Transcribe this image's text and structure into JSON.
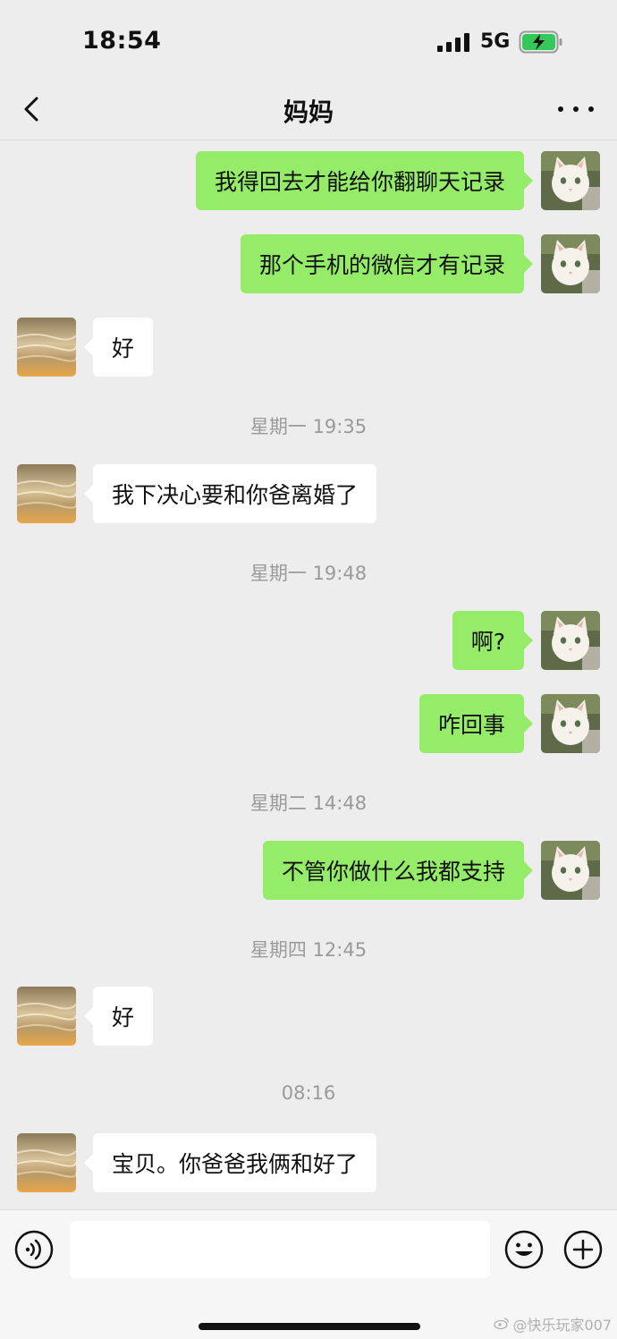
{
  "status_bar": {
    "time": "18:54",
    "network": "5G",
    "battery_charging": true
  },
  "header": {
    "title": "妈妈"
  },
  "messages": [
    {
      "side": "right",
      "text": "我得回去才能给你翻聊天记录"
    },
    {
      "side": "right",
      "text": "那个手机的微信才有记录"
    },
    {
      "side": "left",
      "text": "好"
    },
    {
      "timestamp": "星期一 19:35"
    },
    {
      "side": "left",
      "text": "我下决心要和你爸离婚了"
    },
    {
      "timestamp": "星期一 19:48"
    },
    {
      "side": "right",
      "text": "啊?"
    },
    {
      "side": "right",
      "text": "咋回事"
    },
    {
      "timestamp": "星期二 14:48"
    },
    {
      "side": "right",
      "text": "不管你做什么我都支持"
    },
    {
      "timestamp": "星期四 12:45"
    },
    {
      "side": "left",
      "text": "好"
    },
    {
      "timestamp": "08:16"
    },
    {
      "side": "left",
      "text": "宝贝。你爸爸我俩和好了"
    }
  ],
  "input_bar": {
    "value": "",
    "placeholder": ""
  },
  "watermark": "@快乐玩家007",
  "colors": {
    "background": "#ededed",
    "sent_bubble": "#95ec69",
    "received_bubble": "#ffffff",
    "battery_fill": "#34c759"
  },
  "icons": [
    "signal-icon",
    "battery-charging-icon",
    "back-chevron-icon",
    "more-dots-icon",
    "voice-icon",
    "emoji-icon",
    "plus-icon",
    "weibo-icon"
  ]
}
